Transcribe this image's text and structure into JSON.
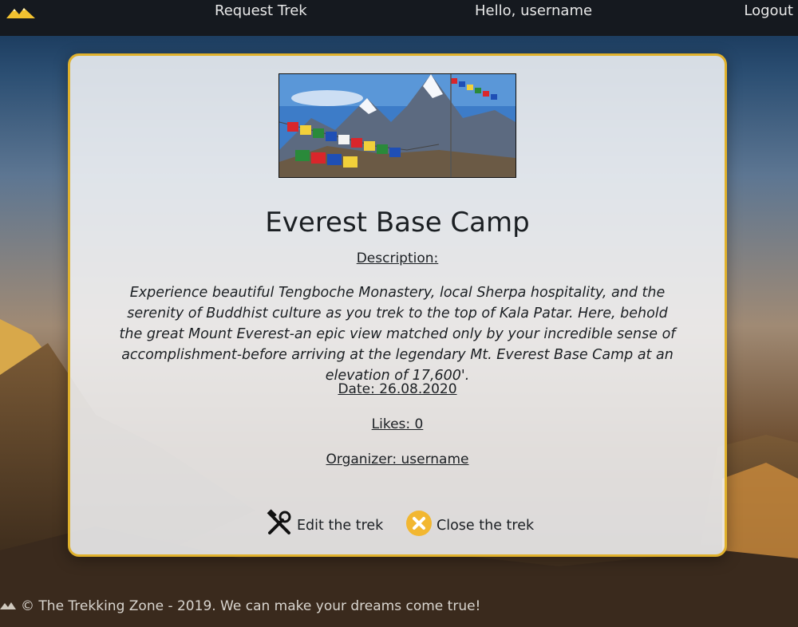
{
  "nav": {
    "request_label": "Request Trek",
    "greeting": "Hello, username",
    "logout_label": "Logout"
  },
  "trek": {
    "title": "Everest Base Camp",
    "description_label": "Description:",
    "description": "Experience beautiful Tengboche Monastery, local Sherpa hospitality, and the serenity of Buddhist culture as you trek to the top of Kala Patar. Here, behold the great Mount Everest-an epic view matched only by your incredible sense of accomplishment-before arriving at the legendary Mt. Everest Base Camp at an elevation of 17,600'.",
    "date": "Date: 26.08.2020",
    "likes": "Likes: 0",
    "organizer": "Organizer: username"
  },
  "actions": {
    "edit_label": "Edit the trek",
    "close_label": "Close the trek"
  },
  "footer": {
    "text": "© The Trekking Zone - 2019. We can make your dreams come true!"
  },
  "colors": {
    "accent": "#e0b12c",
    "nav_bg": "#15191f"
  },
  "icons": {
    "logo": "mountain-logo-icon",
    "edit": "tools-icon",
    "close": "close-circle-icon"
  }
}
